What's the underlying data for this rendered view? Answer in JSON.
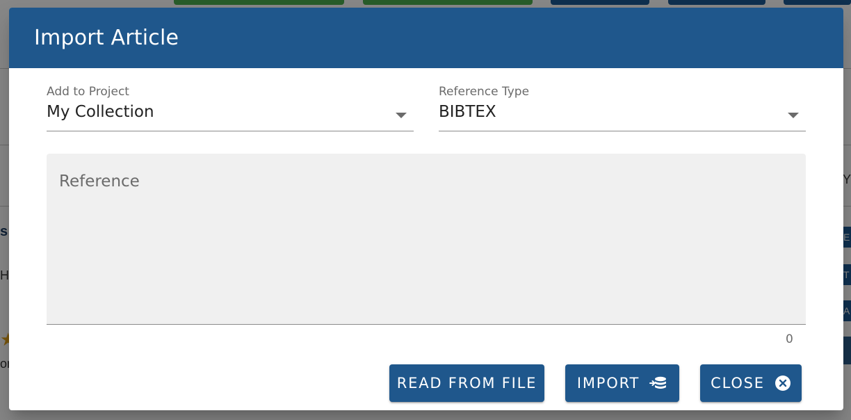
{
  "background": {
    "peek_texts": [
      "s",
      "H",
      "on",
      "Y",
      "E",
      "T",
      "A"
    ]
  },
  "dialog": {
    "title": "Import Article",
    "add_to_project": {
      "label": "Add to Project",
      "value": "My Collection"
    },
    "reference_type": {
      "label": "Reference Type",
      "value": "BIBTEX"
    },
    "reference": {
      "label": "Reference",
      "value": "",
      "char_count": "0"
    },
    "buttons": {
      "read_from_file": "READ FROM FILE",
      "import": "IMPORT",
      "close": "CLOSE"
    },
    "icons": {
      "dropdown": "chevron-down-icon",
      "import": "database-import-icon",
      "close": "close-circle-icon"
    }
  },
  "colors": {
    "header": "#1f578c",
    "button": "#1f578c",
    "field_fill": "#f0f0f0"
  }
}
